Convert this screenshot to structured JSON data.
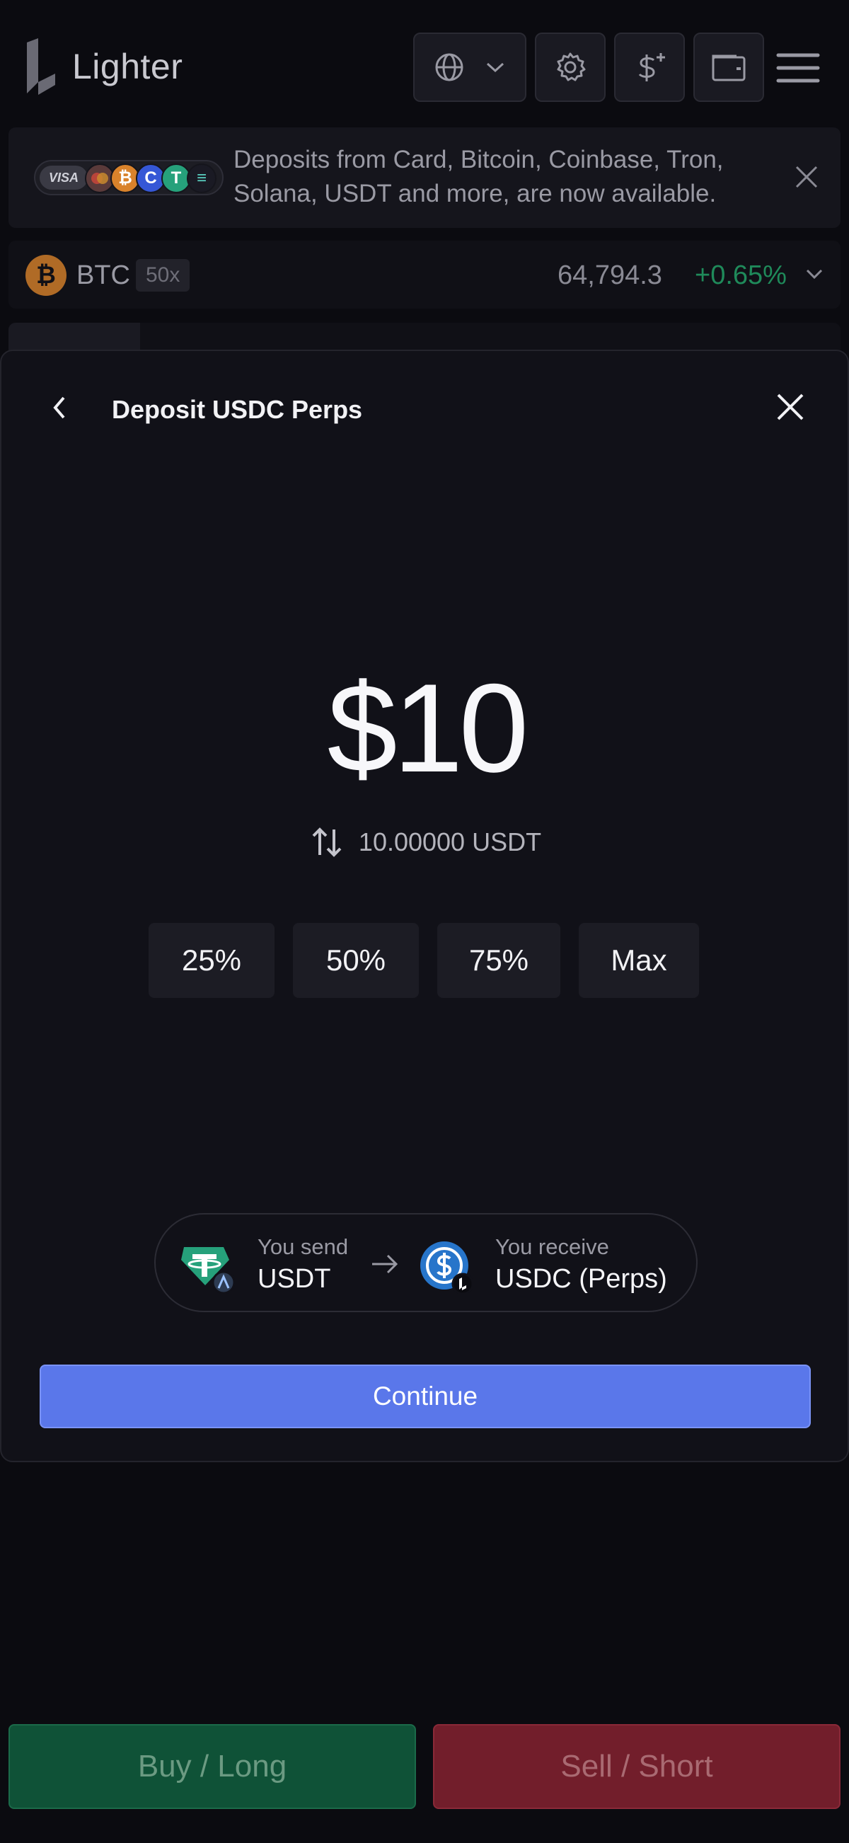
{
  "header": {
    "logo_text": "Lighter",
    "icons": [
      "globe-icon",
      "chevron-down-icon",
      "gear-icon",
      "dollar-plus-icon",
      "wallet-icon",
      "hamburger-menu-icon"
    ]
  },
  "banner": {
    "text": "Deposits from Card, Bitcoin, Coinbase, Tron, Solana, USDT and more, are now available.",
    "visa_label": "VISA",
    "coin_letters": [
      "₿",
      "C",
      "T",
      "≡"
    ]
  },
  "market": {
    "coin_glyph": "₿",
    "symbol": "BTC",
    "leverage": "50x",
    "price": "64,794.3",
    "change": "+0.65%"
  },
  "modal": {
    "title": "Deposit USDC Perps",
    "amount": "$10",
    "conversion": "10.00000 USDT",
    "percent_buttons": [
      "25%",
      "50%",
      "75%",
      "Max"
    ],
    "send_label": "You send",
    "send_token": "USDT",
    "receive_label": "You receive",
    "receive_token": "USDC (Perps)",
    "continue_label": "Continue"
  },
  "actions": {
    "buy_label": "Buy / Long",
    "sell_label": "Sell / Short"
  },
  "colors": {
    "accent": "#5a77ea",
    "positive": "#1f8a5a",
    "buy_bg": "#0f5237",
    "sell_bg": "#721e2b",
    "tether": "#26a17b",
    "usdc": "#2775ca"
  }
}
